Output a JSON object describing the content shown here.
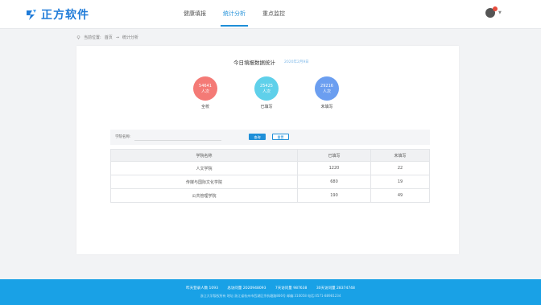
{
  "brand": {
    "name": "正方软件"
  },
  "nav": {
    "items": [
      "健康填报",
      "统计分析",
      "重点监控"
    ],
    "active": 1
  },
  "colors": {
    "accent": "#1f8fd8",
    "footer": "#19a1e6",
    "red": "#f47a76",
    "cyan": "#5fd0ea",
    "blue": "#6b9ef0"
  },
  "breadcrumb": {
    "prefix": "当前位置:",
    "home": "首页",
    "sep": "→",
    "current": "统计分析"
  },
  "card": {
    "title": "今日填报数据统计",
    "date": "2020年2月9日",
    "stats": [
      {
        "value": "54641",
        "unit": "人次",
        "label": "全校"
      },
      {
        "value": "25425",
        "unit": "人次",
        "label": "已填写"
      },
      {
        "value": "29216",
        "unit": "人次",
        "label": "未填写"
      }
    ]
  },
  "search": {
    "label": "学院名称:",
    "placeholder": "",
    "query_button": "查询",
    "reset_button": "重置"
  },
  "table": {
    "headers": [
      "学院名称",
      "已填写",
      "未填写"
    ],
    "rows": [
      [
        "人文学院",
        "1220",
        "22"
      ],
      [
        "传媒与国际文化学院",
        "680",
        "19"
      ],
      [
        "公共管理学院",
        "190",
        "49"
      ]
    ]
  },
  "footer": {
    "stats": [
      "昨天登录人数 1093",
      "总访问量 2020948093",
      "7天访问量 987638",
      "30天访问量 28374748"
    ],
    "copyright": "浙江大学版权所有 地址:浙江省杭州市西湖区余杭塘路866号 邮编:310058 电话:0571-88981234"
  }
}
